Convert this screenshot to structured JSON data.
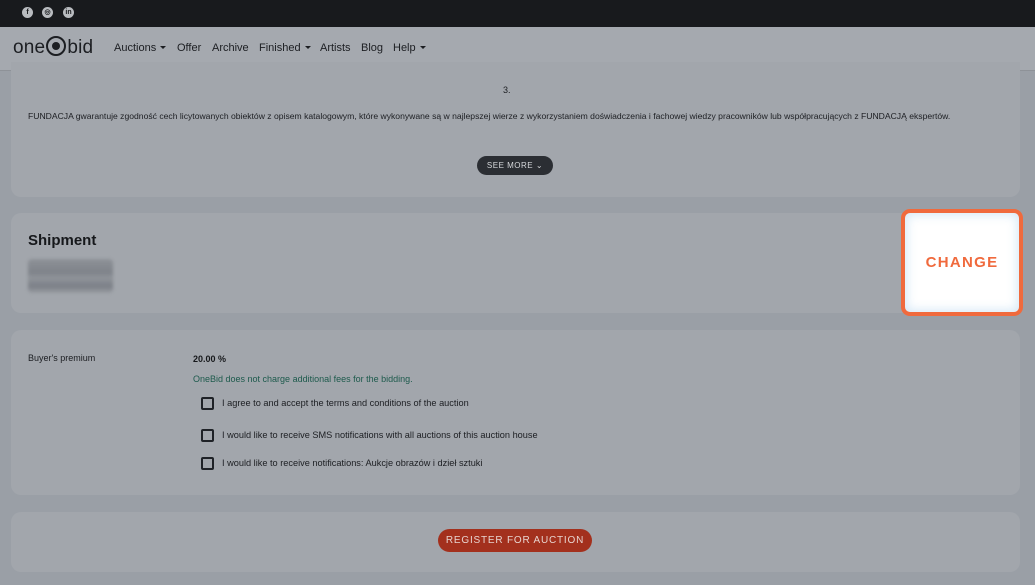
{
  "social": [
    {
      "name": "facebook",
      "glyph": "f"
    },
    {
      "name": "instagram",
      "glyph": "◎"
    },
    {
      "name": "linkedin",
      "glyph": "in"
    }
  ],
  "header": {
    "logo_left": "one",
    "logo_right": "bid",
    "nav": [
      "Auctions",
      "Offer",
      "Archive",
      "Finished",
      "Artists",
      "Blog",
      "Help"
    ]
  },
  "terms": {
    "number": "3.",
    "text": "FUNDACJA gwarantuje zgodność cech licytowanych obiektów z opisem katalogowym, które wykonywane są w najlepszej wierze z wykorzystaniem doświadczenia i fachowej wiedzy pracowników lub współpracujących z FUNDACJĄ ekspertów.",
    "see_more": "SEE MORE"
  },
  "shipment": {
    "title": "Shipment",
    "change": "CHANGE"
  },
  "premium": {
    "label": "Buyer's premium",
    "value": "20.00 %",
    "note": "OneBid does not charge additional fees for the bidding.",
    "checkboxes": [
      "I agree to and accept the terms and conditions of the auction",
      "I would like to receive SMS notifications with all auctions of this auction house",
      "I would like to receive notifications: Aukcje obrazów i dzieł sztuki"
    ]
  },
  "register": {
    "label": "REGISTER FOR AUCTION"
  },
  "colors": {
    "accent": "#f06a3d",
    "register": "#a3301d",
    "note": "#1d5a4c"
  }
}
